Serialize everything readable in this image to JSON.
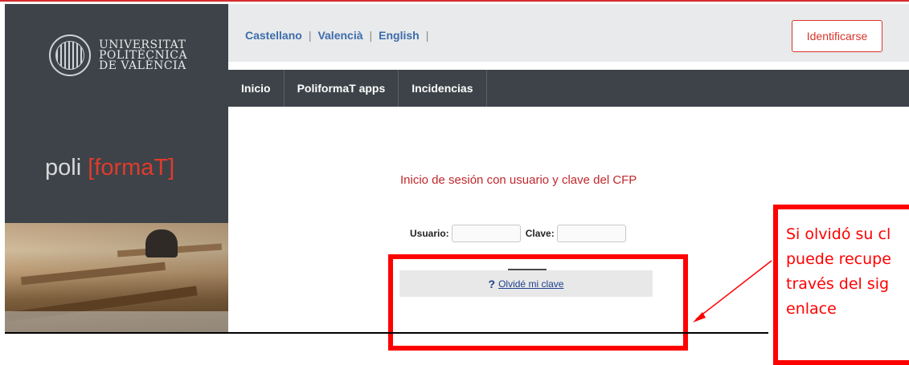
{
  "branding": {
    "university_lines": [
      "UNIVERSITAT",
      "POLITÈCNICA",
      "DE VALÈNCIA"
    ],
    "app_name_left": "poli",
    "app_name_right": "formaT"
  },
  "header": {
    "languages": [
      "Castellano",
      "Valencià",
      "English"
    ],
    "login_button": "Identificarse"
  },
  "nav": {
    "items": [
      "Inicio",
      "PoliformaT apps",
      "Incidencias"
    ]
  },
  "main": {
    "title": "Inicio de sesión con usuario y clave del CFP",
    "user_label": "Usuario:",
    "password_label": "Clave:",
    "forgot_link": "Olvidé mi clave",
    "forgot_icon": "?"
  },
  "annotation": {
    "callout_lines": [
      "Si olvidó su cl",
      "puede recupe",
      "través del sig",
      "enlace"
    ]
  },
  "colors": {
    "accent_red": "#d9342b",
    "annotation_red": "#ff0000",
    "sidebar_dark": "#3d4349",
    "link_blue": "#3d6cab"
  }
}
